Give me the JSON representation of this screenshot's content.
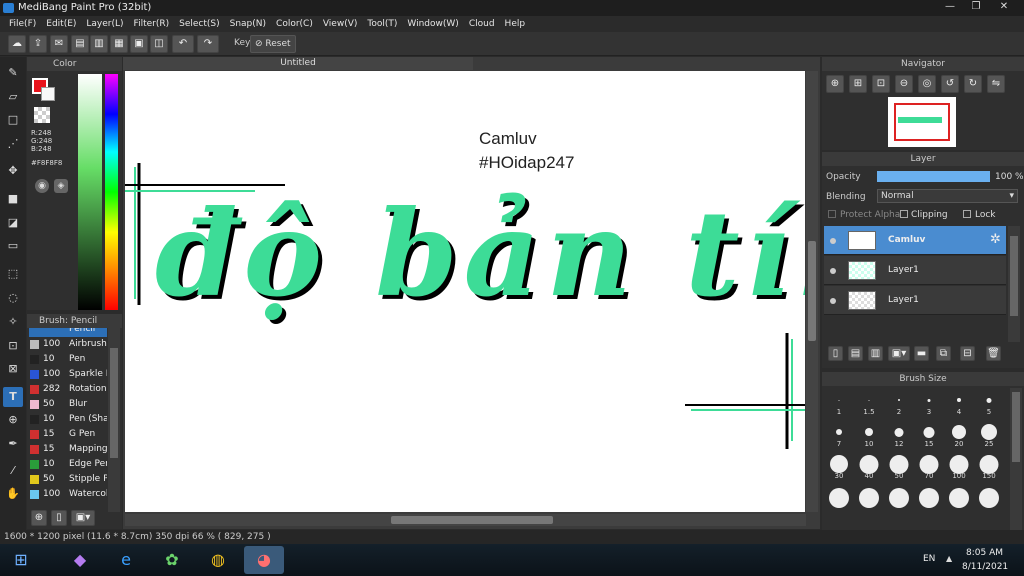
{
  "window": {
    "title": "MediBang Paint Pro (32bit)",
    "minimize": "—",
    "maximize": "❐",
    "close": "✕"
  },
  "menu": [
    "File(F)",
    "Edit(E)",
    "Layer(L)",
    "Filter(R)",
    "Select(S)",
    "Snap(N)",
    "Color(C)",
    "View(V)",
    "Tool(T)",
    "Window(W)",
    "Cloud",
    "Help"
  ],
  "toolbar": {
    "key_label": "Key",
    "reset_label": "Reset"
  },
  "color_panel": {
    "title": "Color",
    "r": "R:248",
    "g": "G:248",
    "b": "B:248",
    "hex": "#F8F8F8"
  },
  "document": {
    "tab": "Untitled",
    "line1": "Camluv",
    "line2": "#HOidap247",
    "lettering": "độ bản tính"
  },
  "brush_panel": {
    "title": "Brush: Pencil",
    "items": [
      {
        "size": "",
        "name": "Pencil",
        "color": "#2c6fb7"
      },
      {
        "size": "100",
        "name": "Airbrush",
        "color": "#bbbbbb"
      },
      {
        "size": "10",
        "name": "Pen",
        "color": "#222222"
      },
      {
        "size": "100",
        "name": "Sparkle B",
        "color": "#2a55d6"
      },
      {
        "size": "282",
        "name": "Rotation",
        "color": "#d03030"
      },
      {
        "size": "50",
        "name": "Blur",
        "color": "#f0b8d0"
      },
      {
        "size": "10",
        "name": "Pen (Sha",
        "color": "#222222"
      },
      {
        "size": "15",
        "name": "G Pen",
        "color": "#d03030"
      },
      {
        "size": "15",
        "name": "Mapping",
        "color": "#d03030"
      },
      {
        "size": "10",
        "name": "Edge Pen",
        "color": "#2a9d3a"
      },
      {
        "size": "50",
        "name": "Stipple P",
        "color": "#e2c91c"
      },
      {
        "size": "100",
        "name": "Watercol",
        "color": "#6ac8f0"
      }
    ]
  },
  "navigator": {
    "title": "Navigator"
  },
  "layer_panel": {
    "title": "Layer",
    "opacity_label": "Opacity",
    "opacity_value": "100 %",
    "opacity_fraction": 1.0,
    "blending_label": "Blending",
    "blending_value": "Normal",
    "protect_alpha": "Protect Alpha",
    "clipping": "Clipping",
    "lock": "Lock",
    "layers": [
      {
        "name": "Camluv",
        "selected": true
      },
      {
        "name": "Layer1",
        "selected": false
      },
      {
        "name": "Layer1",
        "selected": false
      }
    ]
  },
  "brush_size": {
    "title": "Brush Size",
    "sizes": [
      "1",
      "1.5",
      "2",
      "3",
      "4",
      "5",
      "7",
      "10",
      "12",
      "15",
      "20",
      "25",
      "30",
      "40",
      "50",
      "70",
      "100",
      "150"
    ]
  },
  "status": {
    "text": "1600 * 1200 pixel   (11.6 * 8.7cm)   350 dpi   66 %   ( 829, 275 )"
  },
  "taskbar": {
    "lang": "EN",
    "time": "8:05 AM",
    "date": "8/11/2021"
  },
  "colors": {
    "accent": "#2c6fb7",
    "lettering": "#3ddc97",
    "shadow": "#000000"
  }
}
